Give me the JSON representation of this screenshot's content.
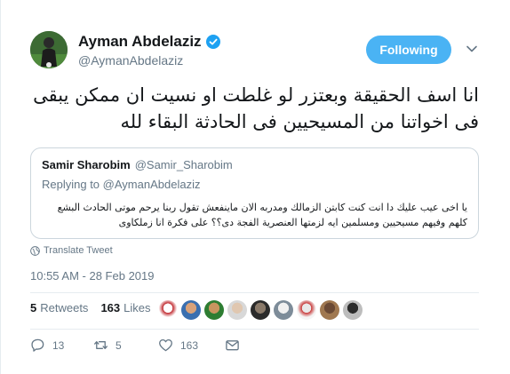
{
  "author": {
    "display_name": "Ayman Abdelaziz",
    "handle": "@AymanAbdelaziz",
    "verified": true,
    "avatar_icon": "user-avatar"
  },
  "follow_button_label": "Following",
  "tweet_text": "انا اسف الحقيقة وبعتزر لو غلطت او نسيت ان ممكن يبقى فى اخواتنا من المسيحيين فى الحادثة البقاء لله",
  "quoted_tweet": {
    "name": "Samir Sharobim",
    "handle": "@Samir_Sharobim",
    "replying_prefix": "Replying to",
    "replying_to": "@AymanAbdelaziz",
    "text": "يا اخى عيب عليك دا انت كنت كابتن الزمالك ومدربه الان ماينفعش تقول ربنا يرحم موتى الحادث البشع كلهم وفيهم مسيحيين ومسلمين ايه لزمتها العنصرية الفجة دى؟؟ على فكرة انا زملكاوى"
  },
  "translate_label": "Translate Tweet",
  "timestamp": "10:55 AM - 28 Feb 2019",
  "stats": {
    "retweets_count": "5",
    "retweets_label": "Retweets",
    "likes_count": "163",
    "likes_label": "Likes"
  },
  "actions": {
    "reply_count": "13",
    "retweet_count": "5",
    "like_count": "163"
  },
  "colors": {
    "accent": "#4ab3f4",
    "verified": "#1da1f2",
    "secondary_text": "#657786",
    "border": "#ccd6dd"
  }
}
